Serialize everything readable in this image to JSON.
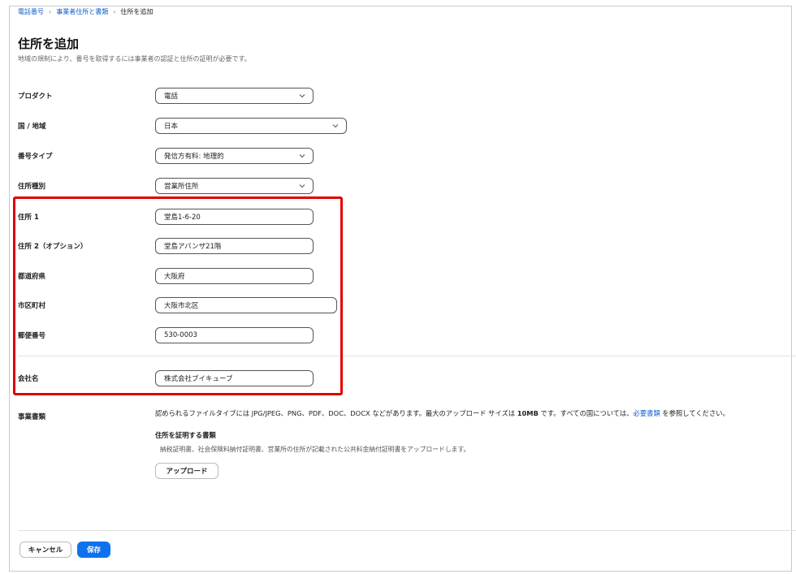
{
  "breadcrumb": {
    "items": [
      "電話番号",
      "事業者住所と書類"
    ],
    "separator": "›",
    "current": "住所を追加"
  },
  "page": {
    "title": "住所を追加",
    "description": "地域の規制により、番号を取得するには事業者の認証と住所の証明が必要です。"
  },
  "form": {
    "product": {
      "label": "プロダクト",
      "value": "電話"
    },
    "country": {
      "label": "国 / 地域",
      "value": "日本"
    },
    "number_type": {
      "label": "番号タイプ",
      "value": "発信方有料: 地理的"
    },
    "address_type": {
      "label": "住所種別",
      "value": "営業所住所"
    },
    "address1": {
      "label": "住所 1",
      "value": "堂島1-6-20"
    },
    "address2": {
      "label": "住所 2（オプション）",
      "value": "堂島アバンザ21階"
    },
    "prefecture": {
      "label": "都道府県",
      "value": "大阪府"
    },
    "city": {
      "label": "市区町村",
      "value": "大阪市北区"
    },
    "postal_code": {
      "label": "郵便番号",
      "value": "530-0003"
    },
    "company_name": {
      "label": "会社名",
      "value": "株式会社ブイキューブ"
    }
  },
  "documents": {
    "label": "事業書類",
    "text_before": "認められるファイルタイプには JPG/JPEG、PNG、PDF、DOC、DOCX などがあります。最大のアップロード サイズは ",
    "max_size": "10MB",
    "text_middle": " です。すべての国については、",
    "link_text": "必要書類",
    "text_after": " を参照してください。",
    "proof_title": "住所を証明する書類",
    "proof_desc": "納税証明書、社会保険料納付証明書、営業所の住所が記載された公共料金納付証明書をアップロードします。",
    "upload_label": "アップロード"
  },
  "footer": {
    "cancel_label": "キャンセル",
    "save_label": "保存"
  },
  "colors": {
    "link": "#0e5ccf",
    "primary": "#0e72ed",
    "highlight": "#e00000"
  }
}
